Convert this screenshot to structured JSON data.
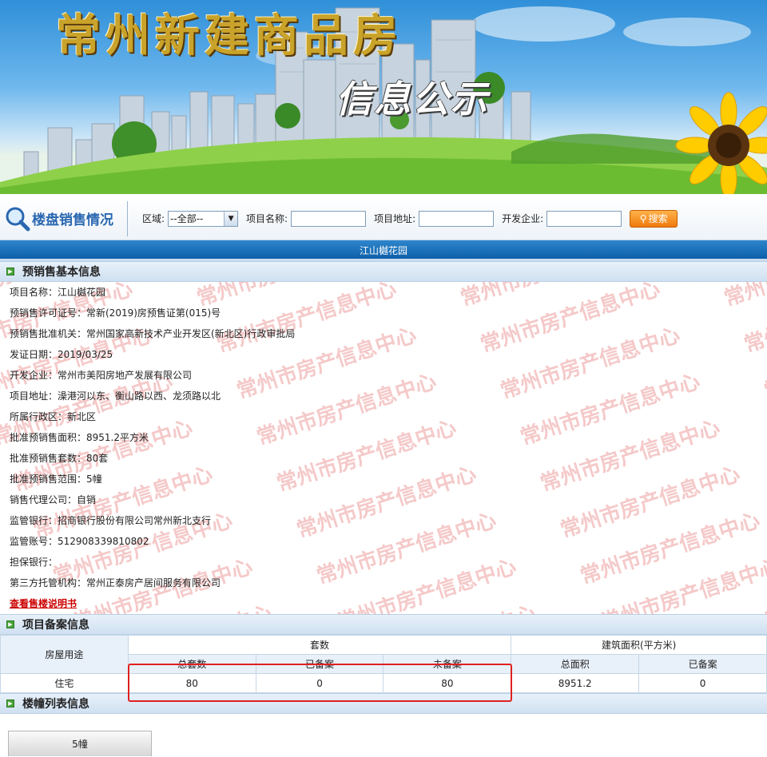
{
  "banner": {
    "title": "常州新建商品房",
    "subtitle": "信息公示"
  },
  "search": {
    "section_label": "楼盘销售情况",
    "district_label": "区域:",
    "district_value": "--全部--",
    "project_name_label": "项目名称:",
    "project_address_label": "项目地址:",
    "developer_label": "开发企业:",
    "search_button": "搜索"
  },
  "project_bar": "江山樾花园",
  "presale_section": {
    "title": "预销售基本信息",
    "rows": [
      "项目名称：江山樾花园",
      "预销售许可证号：常新(2019)房预售证第(015)号",
      "预销售批准机关：常州国家高新技术产业开发区(新北区)行政审批局",
      "发证日期：2019/03/25",
      "开发企业：常州市美阳房地产发展有限公司",
      "项目地址：澡港河以东、衡山路以西、龙须路以北",
      "所属行政区：新北区",
      "批准预销售面积：8951.2平方米",
      "批准预销售套数：80套",
      "批准预销售范围：5幢",
      "销售代理公司：自销",
      "监管银行：招商银行股份有限公司常州新北支行",
      "监管账号：512908339810802",
      "担保银行：",
      "第三方托管机构：常州正泰房产居间服务有限公司"
    ],
    "link": "查看售楼说明书",
    "watermark": "常州市房产信息中心"
  },
  "filing_section": {
    "title": "项目备案信息",
    "col_usage": "房屋用途",
    "group_units": "套数",
    "group_area": "建筑面积(平方米)",
    "sub_headers": [
      "总套数",
      "已备案",
      "未备案",
      "总面积",
      "已备案"
    ],
    "row": {
      "usage": "住宅",
      "values": [
        "80",
        "0",
        "80",
        "8951.2",
        "0"
      ]
    }
  },
  "building_section": {
    "title": "楼幢列表信息",
    "buildings": [
      "5幢"
    ]
  },
  "colors": {
    "accent_blue": "#0a5fa9",
    "search_orange": "#ef7a0c",
    "highlight_red": "#e02020",
    "watermark_red": "#f2b8b8"
  }
}
